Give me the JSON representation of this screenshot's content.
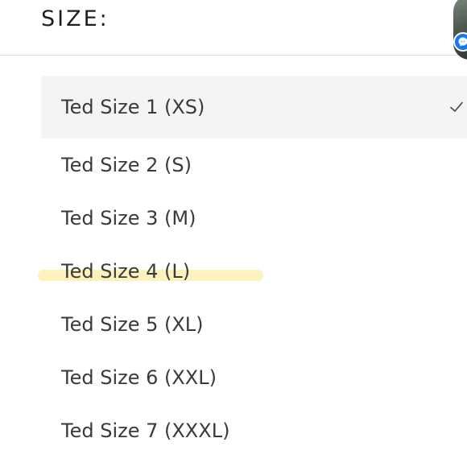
{
  "header": {
    "size_label": "SIZE:"
  },
  "options": [
    {
      "label": "Ted Size 1 (XS)",
      "selected": true
    },
    {
      "label": "Ted Size 2 (S)",
      "selected": false
    },
    {
      "label": "Ted Size 3 (M)",
      "selected": false
    },
    {
      "label": "Ted Size 4 (L)",
      "selected": false,
      "highlighted": true
    },
    {
      "label": "Ted Size 5 (XL)",
      "selected": false
    },
    {
      "label": "Ted Size 6 (XXL)",
      "selected": false
    },
    {
      "label": "Ted Size 7 (XXXL)",
      "selected": false
    }
  ],
  "icons": {
    "selected_indicator": "check-icon",
    "avatar_badge": "messenger-icon"
  },
  "colors": {
    "selected_row_bg": "#f4f4f4",
    "highlight": "#fdeeb0",
    "badge": "#1877f2"
  }
}
